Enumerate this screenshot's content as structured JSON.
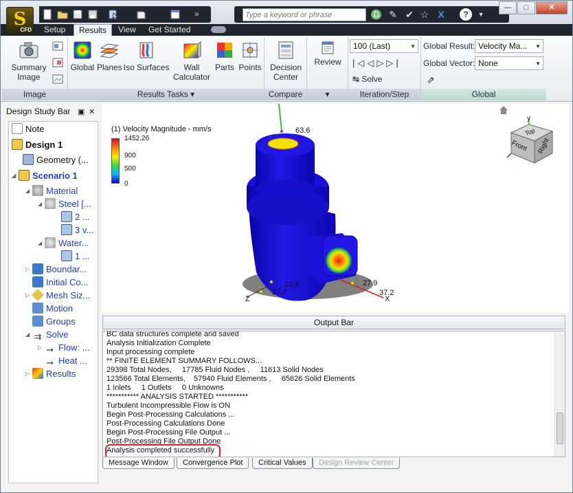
{
  "app": {
    "logo_letter": "S",
    "logo_sub": "CFD"
  },
  "search": {
    "placeholder": "Type a keyword or phrase"
  },
  "tabs": [
    "Setup",
    "Results",
    "View",
    "Get Started"
  ],
  "ribbon": {
    "image_panel": {
      "title": "Image",
      "summary_image": "Summary Image"
    },
    "results_tasks": {
      "title": "Results Tasks",
      "buttons": [
        "Global",
        "Planes",
        "Iso Surfaces",
        "Wall Calculator",
        "Parts",
        "Points"
      ]
    },
    "compare": {
      "title": "Compare",
      "decision_center": "Decision Center"
    },
    "review": {
      "label": "Review"
    },
    "iteration": {
      "title": "Iteration/Step",
      "step_value": "100 (Last)",
      "solve": "Solve"
    },
    "global": {
      "title": "Global",
      "result_label": "Global Result:",
      "result_value": "Velocity Ma...",
      "vector_label": "Global Vector:",
      "vector_value": "None"
    }
  },
  "design_study": {
    "title": "Design Study Bar",
    "items": [
      {
        "label": "Note"
      },
      {
        "label": "Design 1"
      },
      {
        "label": "Geometry (..."
      },
      {
        "label": "Scenario 1"
      },
      {
        "label": "Material"
      },
      {
        "label": "Steel [..."
      },
      {
        "label": "2 ..."
      },
      {
        "label": "3 v..."
      },
      {
        "label": "Water..."
      },
      {
        "label": "1 ..."
      },
      {
        "label": "Boundar..."
      },
      {
        "label": "Initial Co..."
      },
      {
        "label": "Mesh Siz..."
      },
      {
        "label": "Motion"
      },
      {
        "label": "Groups"
      },
      {
        "label": "Solve"
      },
      {
        "label": "Flow: ..."
      },
      {
        "label": "Heat ..."
      },
      {
        "label": "Results"
      }
    ]
  },
  "viewport": {
    "legend_title": "(1) Velocity Magnitude - mm/s",
    "legend_values": [
      "1452.26",
      "900",
      "500",
      "0"
    ],
    "annotations": [
      "63.6",
      "27.9",
      "37.2",
      "27.2",
      "10.4"
    ],
    "axes": {
      "x": "X",
      "y": "y",
      "z": "Z"
    },
    "viewcube": {
      "top": "Top",
      "front": "Front",
      "right": "Right"
    }
  },
  "output": {
    "bar_label": "Output Bar",
    "messages": [
      "BC data structures complete and saved",
      "Analysis Initialization Complete",
      "Input processing complete",
      "** FINITE ELEMENT SUMMARY FOLLOWS...",
      "29398 Total Nodes,     17785 Fluid Nodes ,     11613 Solid Nodes",
      "123566 Total Elements,    57940 Fluid Elements ,     65626 Solid Elements",
      "1 Inlets     1 Outlets     0 Unknowns",
      "*********** ANALYSIS STARTED ***********",
      "Turbulent Incompressible Flow is ON",
      "Begin Post-Processing Calculations ...",
      "Post-Processing Calculations Done",
      "Begin Post-Processing File Output ...",
      "Post-Processing File Output Done",
      "Analysis completed successfully"
    ],
    "bottom_tabs": [
      "Message Window",
      "Convergence Plot",
      "Critical Values",
      "Design Review Center"
    ]
  },
  "colors": {
    "model_blue": "#1a10d8",
    "highlight_red": "#e02020",
    "ribbon_dark": "#1f2630"
  }
}
